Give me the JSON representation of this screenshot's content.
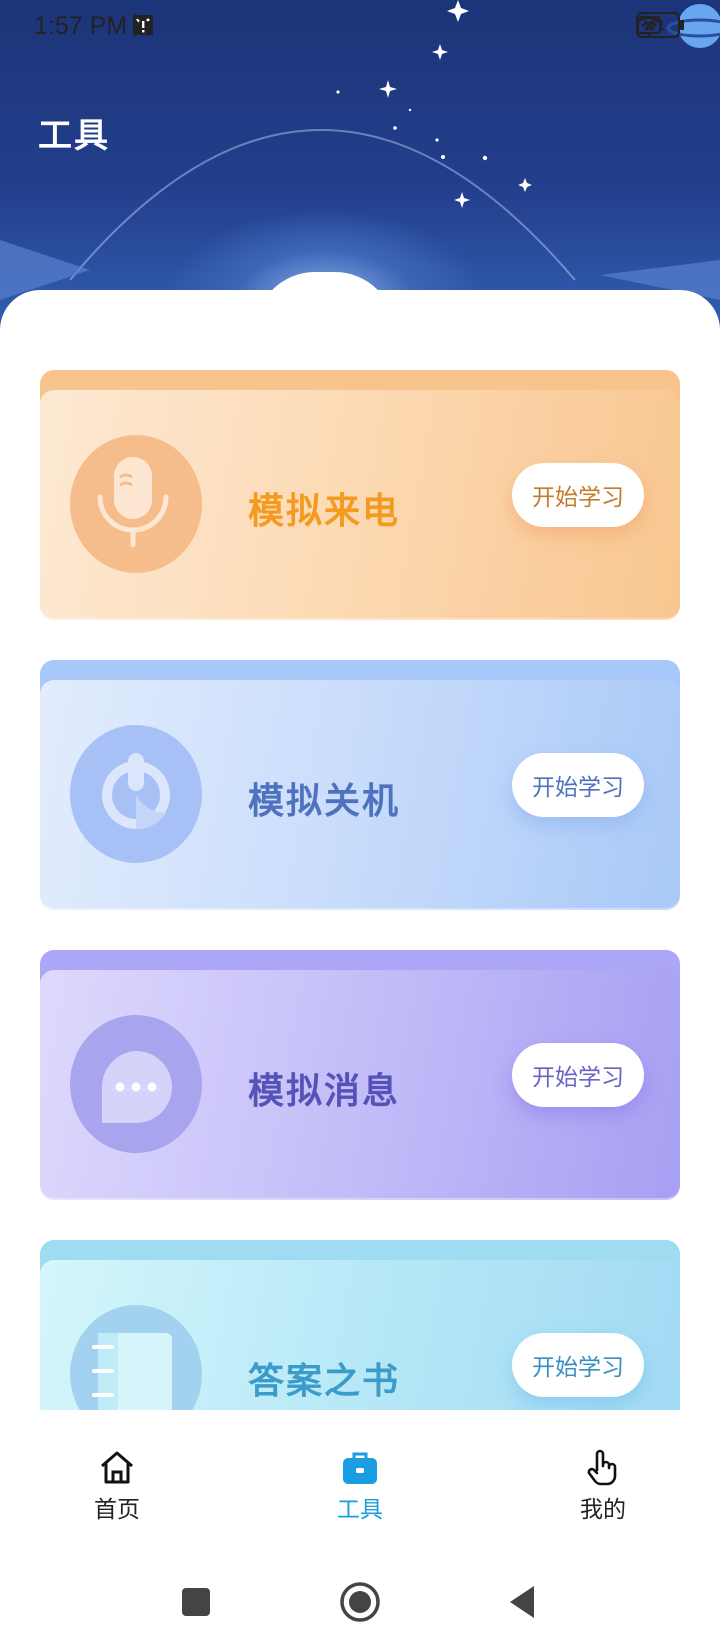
{
  "status_bar": {
    "time": "1:57 PM",
    "battery": "71",
    "left_icons": [
      "mute-icon",
      "app-icon",
      "play-store-icon",
      "warning-icon"
    ],
    "right_icons": [
      "sim-off-icon",
      "wifi-icon",
      "battery-icon"
    ]
  },
  "header": {
    "title": "工具"
  },
  "tools": [
    {
      "title": "模拟来电",
      "button": "开始学习",
      "icon": "microphone-icon",
      "accent": "#f39a1f"
    },
    {
      "title": "模拟关机",
      "button": "开始学习",
      "icon": "power-icon",
      "accent": "#4f72bf"
    },
    {
      "title": "模拟消息",
      "button": "开始学习",
      "icon": "chat-bubble-icon",
      "accent": "#5653b8"
    },
    {
      "title": "答案之书",
      "button": "开始学习",
      "icon": "notebook-icon",
      "accent": "#3c9cc9"
    }
  ],
  "tabbar": {
    "active_color": "#1a9ee0",
    "items": [
      {
        "label": "首页",
        "icon": "home-icon"
      },
      {
        "label": "工具",
        "icon": "toolbox-icon",
        "active": true
      },
      {
        "label": "我的",
        "icon": "hand-pointer-icon"
      }
    ]
  },
  "system_nav": {
    "icons": [
      "recents-icon",
      "home-circle-icon",
      "back-icon"
    ]
  }
}
